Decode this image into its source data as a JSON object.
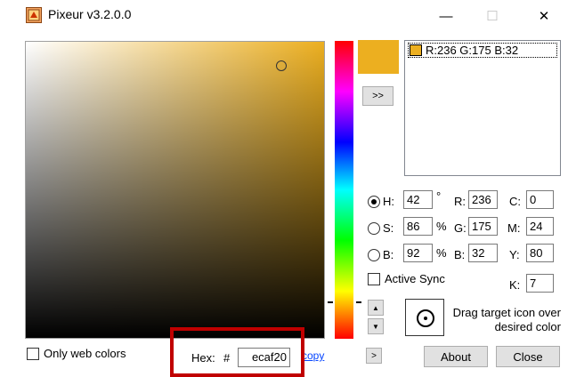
{
  "window": {
    "title": "Pixeur v3.2.0.0",
    "minimize_glyph": "—",
    "maximize_glyph": "☐",
    "close_glyph": "✕"
  },
  "color": {
    "hex_value": "#ECAF20",
    "swatch_color": "#ECAF20"
  },
  "expand_button_label": ">>",
  "history": {
    "items": [
      {
        "text": "R:236 G:175 B:32",
        "color": "#ECAF20"
      }
    ]
  },
  "hsb": {
    "h_label": "H:",
    "h_value": "42",
    "h_unit": "°",
    "s_label": "S:",
    "s_value": "86",
    "s_unit": "%",
    "b_label": "B:",
    "b_value": "92",
    "b_unit": "%",
    "selected": "H"
  },
  "rgb": {
    "r_label": "R:",
    "r_value": "236",
    "g_label": "G:",
    "g_value": "175",
    "b_label": "B:",
    "b_value": "32"
  },
  "cmyk": {
    "c_label": "C:",
    "c_value": "0",
    "m_label": "M:",
    "m_value": "24",
    "y_label": "Y:",
    "y_value": "80",
    "k_label": "K:",
    "k_value": "7"
  },
  "active_sync": {
    "label": "Active Sync",
    "checked": false
  },
  "only_web_colors": {
    "label": "Only web colors",
    "checked": false
  },
  "hex": {
    "label": "Hex:",
    "hash": "#",
    "value": "ecaf20",
    "copy_label": "copy"
  },
  "target": {
    "hint": "Drag target icon over desired color"
  },
  "buttons": {
    "small_label": ">",
    "about": "About",
    "close": "Close"
  }
}
